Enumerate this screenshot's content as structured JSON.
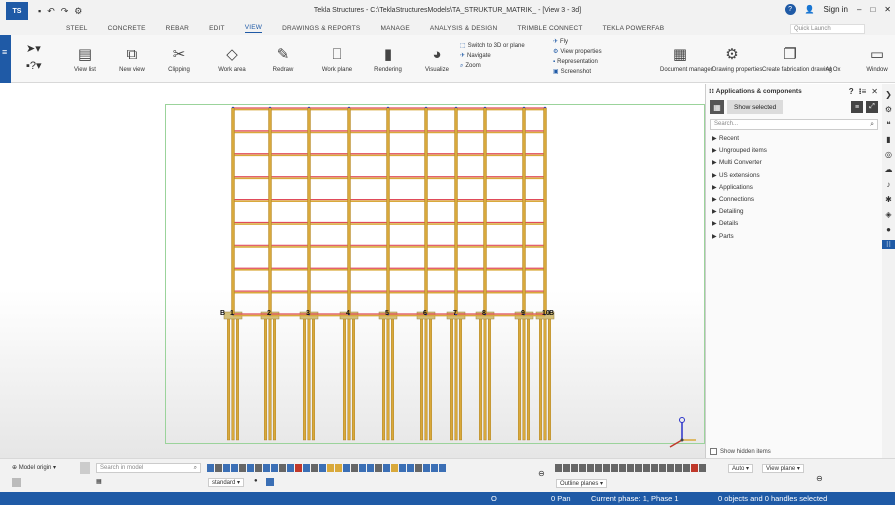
{
  "titlebar": {
    "title": "Tekla Structures - C:\\TeklaStructuresModels\\TA_STRUKTUR_MATRIK_ - [View 3 - 3d]",
    "signin": "Sign in",
    "logo": "TS"
  },
  "tabs": [
    "STEEL",
    "CONCRETE",
    "REBAR",
    "EDIT",
    "VIEW",
    "DRAWINGS & REPORTS",
    "MANAGE",
    "ANALYSIS & DESIGN",
    "TRIMBLE CONNECT",
    "TEKLA POWERFAB"
  ],
  "active_tab": "VIEW",
  "quick_launch": {
    "placeholder": "Quick Launch"
  },
  "ribbon": {
    "buttons": [
      {
        "label": "View list",
        "icon": "view-list-icon"
      },
      {
        "label": "New view",
        "icon": "new-view-icon"
      },
      {
        "label": "Clipping",
        "icon": "clipping-icon"
      },
      {
        "label": "Work area",
        "icon": "work-area-icon"
      },
      {
        "label": "Redraw",
        "icon": "redraw-icon"
      },
      {
        "label": "Work plane",
        "icon": "work-plane-icon"
      },
      {
        "label": "Rendering",
        "icon": "rendering-icon"
      },
      {
        "label": "Visualize",
        "icon": "visualize-icon"
      }
    ],
    "small_left": [
      "Switch to 3D or plane",
      "Navigate",
      "Zoom"
    ],
    "small_right": [
      "Fly",
      "View properties",
      "Representation",
      "Screenshot"
    ],
    "right_buttons": [
      {
        "label": "Document manager"
      },
      {
        "label": "Drawing properties"
      },
      {
        "label": "Create fabrication drawing"
      },
      {
        "label": "AI Ox"
      },
      {
        "label": "Window"
      }
    ]
  },
  "panel": {
    "title": "Applications & components",
    "show_selected": "Show selected",
    "search_placeholder": "Search...",
    "items": [
      "Recent",
      "Ungrouped items",
      "Multi Converter",
      "US extensions",
      "Applications",
      "Connections",
      "Detailing",
      "Details",
      "Parts"
    ],
    "show_hidden": "Show hidden items"
  },
  "model": {
    "column_labels": [
      "1",
      "2",
      "3",
      "4",
      "5",
      "6",
      "7",
      "8",
      "9",
      "10"
    ],
    "end_labels": [
      "B",
      "B"
    ],
    "floors": 9
  },
  "bottom": {
    "model_origin": "Model origin",
    "search_placeholder": "Search in model",
    "standard": "standard",
    "auto": "Auto",
    "view_plane": "View plane",
    "outline_planes": "Outline planes"
  },
  "status": {
    "o": "O",
    "pan": "0 Pan",
    "phase": "Current phase: 1, Phase 1",
    "selection": "0 objects and 0 handles selected"
  },
  "colors": {
    "accent": "#1f5aa6",
    "column": "#d9a93b",
    "beam_red": "#e04b5a",
    "node_blue": "#2a33c9"
  }
}
